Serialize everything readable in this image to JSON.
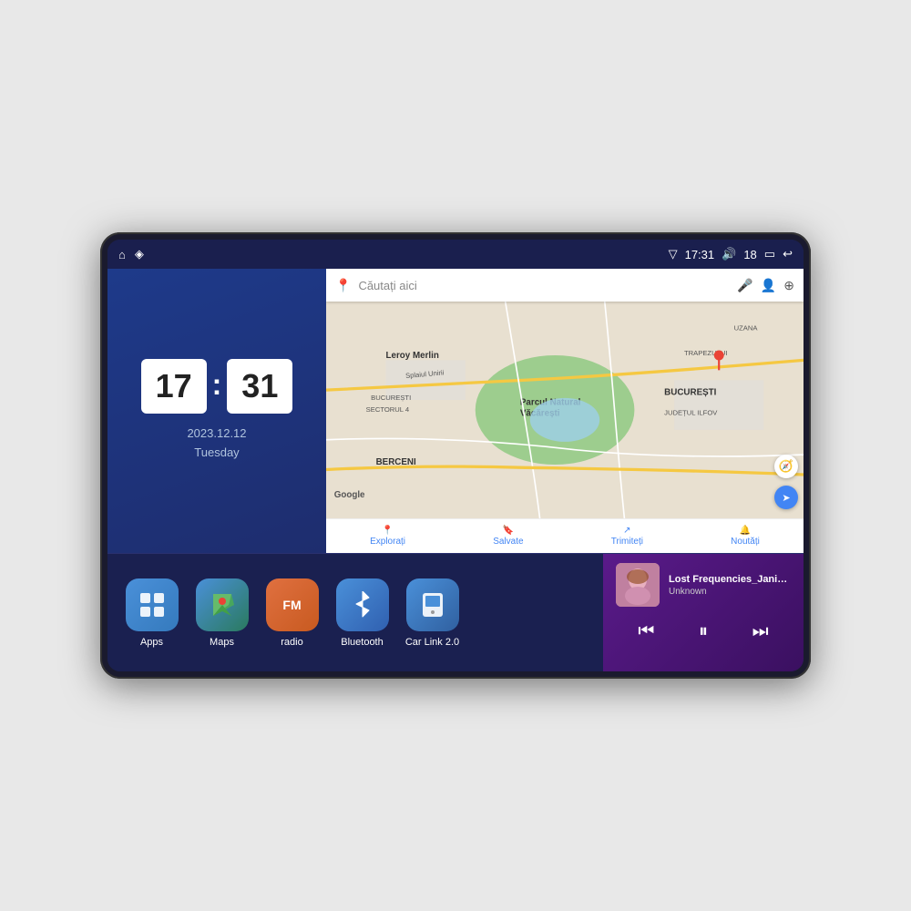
{
  "device": {
    "status_bar": {
      "left_icons": [
        "home-icon",
        "maps-pin-icon"
      ],
      "signal_icon": "▽",
      "time": "17:31",
      "volume_icon": "🔊",
      "battery_level": "18",
      "battery_icon": "🔋",
      "back_icon": "↩"
    },
    "clock": {
      "hours": "17",
      "minutes": "31",
      "date": "2023.12.12",
      "day": "Tuesday"
    },
    "map": {
      "search_placeholder": "Căutați aici",
      "nav_items": [
        {
          "label": "Explorați",
          "active": true
        },
        {
          "label": "Salvate",
          "active": false
        },
        {
          "label": "Trimiteți",
          "active": false
        },
        {
          "label": "Noutăți",
          "active": false
        }
      ],
      "labels": [
        "Parcul Natural Văcărești",
        "Leroy Merlin",
        "BUCUREȘTI",
        "SECTORUL 4",
        "BERCENI",
        "BUCUREȘTI",
        "JUDEȚUL ILFOV",
        "Splaiul Unirii",
        "TRAPEZULUI",
        "UZANA"
      ]
    },
    "apps": [
      {
        "id": "apps",
        "label": "Apps",
        "icon": "⊞"
      },
      {
        "id": "maps",
        "label": "Maps",
        "icon": "📍"
      },
      {
        "id": "radio",
        "label": "radio",
        "icon": "FM"
      },
      {
        "id": "bluetooth",
        "label": "Bluetooth",
        "icon": "⚡"
      },
      {
        "id": "carlink",
        "label": "Car Link 2.0",
        "icon": "📱"
      }
    ],
    "music": {
      "title": "Lost Frequencies_Janieck Devy-...",
      "artist": "Unknown",
      "prev_btn": "⏮",
      "play_btn": "⏸",
      "next_btn": "⏭"
    }
  }
}
